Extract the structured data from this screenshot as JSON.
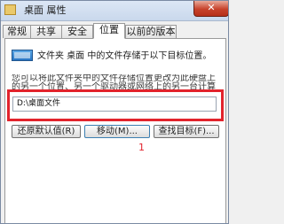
{
  "window": {
    "title": "桌面 属性",
    "close_label": "✕"
  },
  "tabs": [
    {
      "label": "常规",
      "active": false
    },
    {
      "label": "共享",
      "active": false
    },
    {
      "label": "安全",
      "active": false
    },
    {
      "label": "位置",
      "active": true
    },
    {
      "label": "以前的版本",
      "active": false
    }
  ],
  "location": {
    "description": "文件夹 桌面 中的文件存储于以下目标位置。",
    "info_lines": [
      "您可以将此文件夹中的文件存储位置更改为此硬盘上",
      "的另一个位置、另一个驱动器或网络上的另一台计算"
    ],
    "path_value": "D:\\桌面文件"
  },
  "buttons": {
    "restore_default": "还原默认值(R)",
    "move": "移动(M)...",
    "find_target": "查找目标(F)..."
  },
  "annotation": {
    "marker": "1",
    "color": "#e2232c"
  },
  "icons": {
    "title": "folder-icon",
    "location": "folder-icon"
  }
}
